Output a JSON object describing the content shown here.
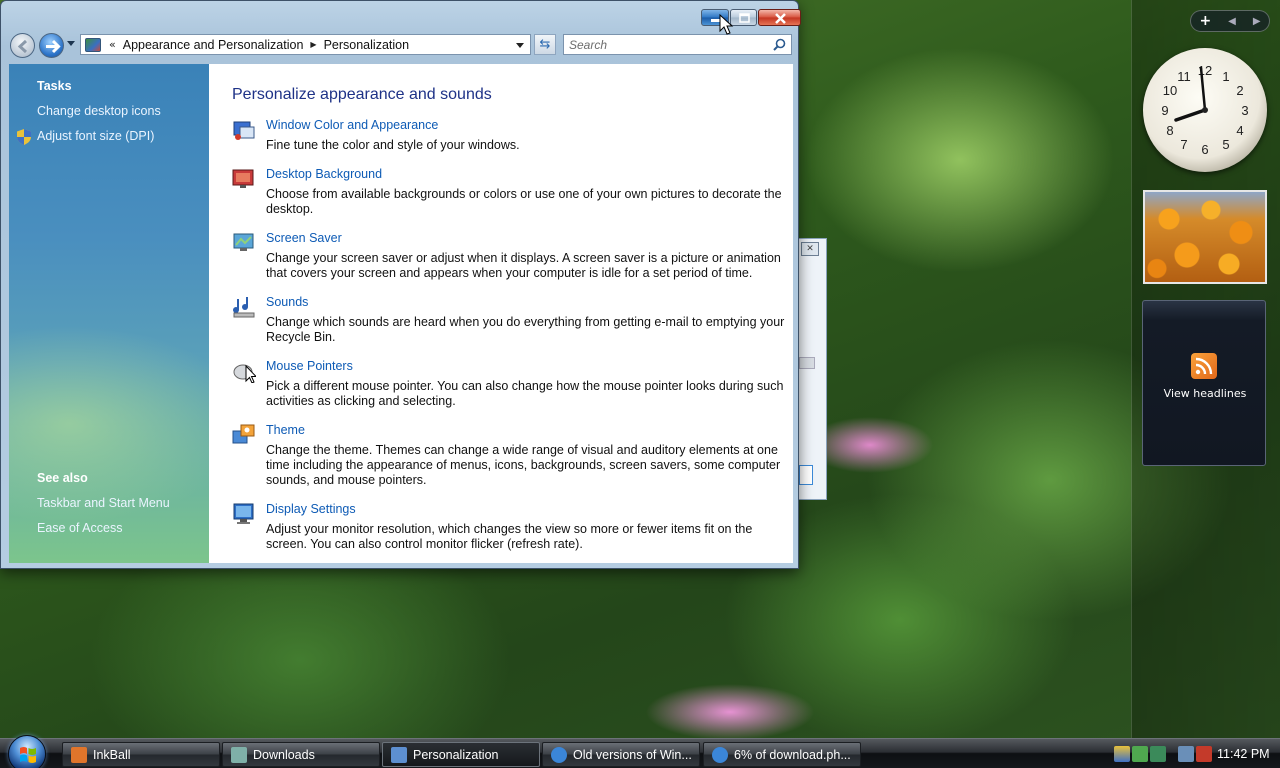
{
  "window": {
    "breadcrumb": {
      "overflow": "«",
      "parts": [
        "Appearance and Personalization",
        "Personalization"
      ]
    },
    "search_placeholder": "Search",
    "left_pane": {
      "tasks_heading": "Tasks",
      "tasks": [
        "Change desktop icons",
        "Adjust font size (DPI)"
      ],
      "see_also_heading": "See also",
      "see_also": [
        "Taskbar and Start Menu",
        "Ease of Access"
      ]
    },
    "content": {
      "title": "Personalize appearance and sounds",
      "items": [
        {
          "link": "Window Color and Appearance",
          "desc": "Fine tune the color and style of your windows.",
          "icon": "window-color-icon"
        },
        {
          "link": "Desktop Background",
          "desc": "Choose from available backgrounds or colors or use one of your own pictures to decorate the desktop.",
          "icon": "desktop-background-icon"
        },
        {
          "link": "Screen Saver",
          "desc": "Change your screen saver or adjust when it displays. A screen saver is a picture or animation that covers your screen and appears when your computer is idle for a set period of time.",
          "icon": "screen-saver-icon"
        },
        {
          "link": "Sounds",
          "desc": "Change which sounds are heard when you do everything from getting e-mail to emptying your Recycle Bin.",
          "icon": "sounds-icon"
        },
        {
          "link": "Mouse Pointers",
          "desc": "Pick a different mouse pointer. You can also change how the mouse pointer looks during such activities as clicking and selecting.",
          "icon": "mouse-pointers-icon"
        },
        {
          "link": "Theme",
          "desc": "Change the theme. Themes can change a wide range of visual and auditory elements at one time including the appearance of menus, icons, backgrounds, screen savers, some computer sounds, and mouse pointers.",
          "icon": "theme-icon"
        },
        {
          "link": "Display Settings",
          "desc": "Adjust your monitor resolution, which changes the view so more or fewer items fit on the screen. You can also control monitor flicker (refresh rate).",
          "icon": "display-settings-icon"
        }
      ]
    }
  },
  "sidebar": {
    "clock": {
      "numerals": [
        "12",
        "1",
        "2",
        "3",
        "4",
        "5",
        "6",
        "7",
        "8",
        "9",
        "10",
        "11"
      ]
    },
    "feed_label": "View headlines"
  },
  "taskbar": {
    "tasks": [
      {
        "label": "InkBall",
        "icon": "inkball-icon",
        "color": "#e0752b"
      },
      {
        "label": "Downloads",
        "icon": "folder-icon",
        "color": "#7fb0a8"
      },
      {
        "label": "Personalization",
        "icon": "control-panel-icon",
        "color": "#5d8fd0",
        "active": true
      },
      {
        "label": "Old versions of Win...",
        "icon": "internet-explorer-icon",
        "color": "#3b86d8"
      },
      {
        "label": "6% of download.ph...",
        "icon": "internet-explorer-icon",
        "color": "#3b86d8"
      }
    ],
    "time": "11:42 PM"
  },
  "colors": {
    "link": "#0e5bb5",
    "title": "#1e3287",
    "left_pane": "#4a8fbf"
  }
}
